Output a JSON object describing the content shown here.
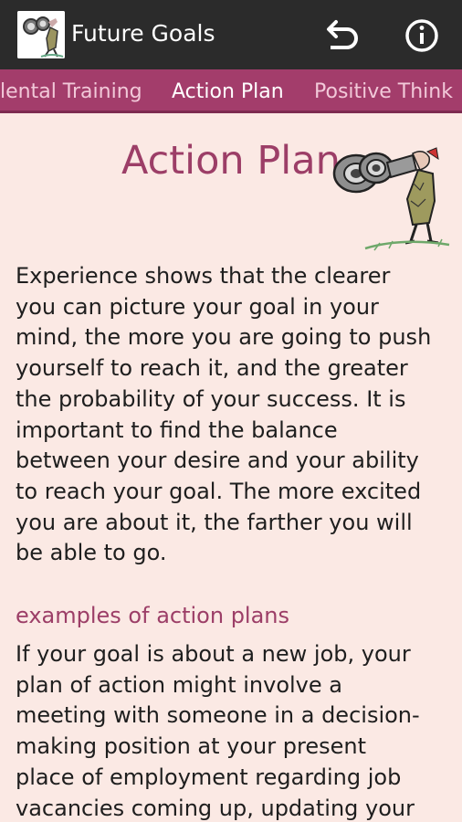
{
  "app": {
    "title": "Future Goals"
  },
  "actions": {
    "undo_icon": "undo-icon",
    "info_icon": "info-icon"
  },
  "tabs": [
    {
      "label": "Mental Training",
      "visible_text": "lental Training",
      "active": false
    },
    {
      "label": "Action Plan",
      "active": true
    },
    {
      "label": "Positive Think",
      "active": false
    }
  ],
  "page": {
    "title": "Action Plan",
    "paragraph1_lines": [
      "Experience shows that the clearer",
      "you can picture your goal in your",
      "mind, the more you are going to push",
      "yourself to reach it, and the greater",
      "the probability of your success. It is",
      "important to find the balance",
      "between your desire and your ability",
      "to reach your goal. The more excited",
      "you are about it, the farther you will",
      "be able to go."
    ],
    "subheading": "examples of action plans",
    "paragraph2_lines": [
      "If your goal is about a new job, your",
      "plan of action might involve a",
      "meeting with someone in a decision-",
      "making position at your present",
      "place of employment regarding job",
      "vacancies coming up, updating your"
    ]
  },
  "colors": {
    "actionbar": "#2b2b2b",
    "tabbar": "#a33d6b",
    "background": "#fbe9e4",
    "accent": "#9c3e67"
  }
}
